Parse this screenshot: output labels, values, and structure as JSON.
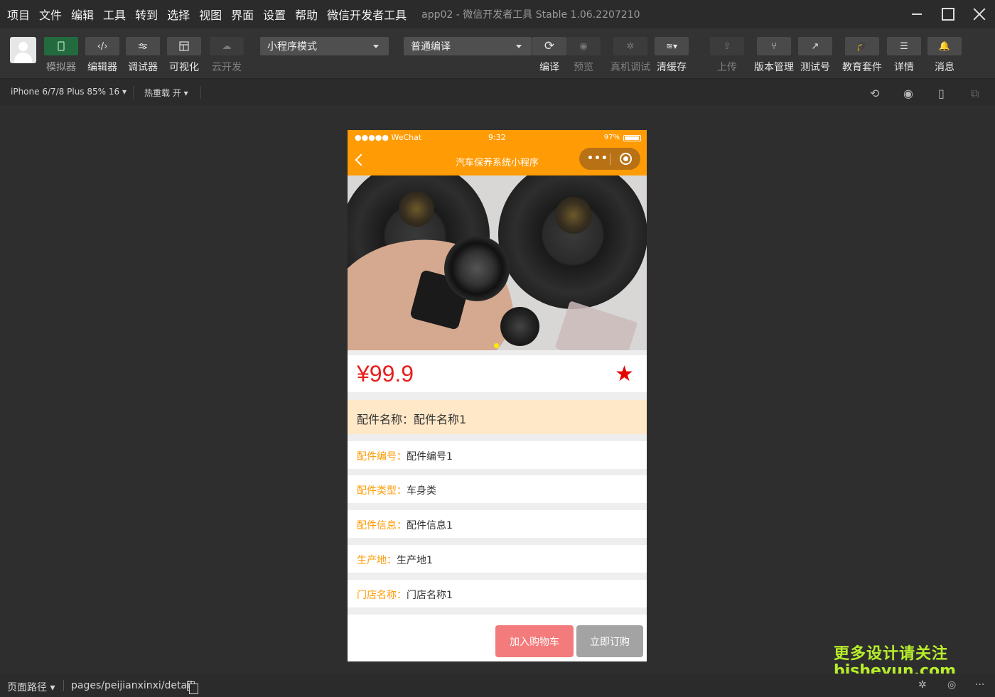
{
  "menu": [
    "项目",
    "文件",
    "编辑",
    "工具",
    "转到",
    "选择",
    "视图",
    "界面",
    "设置",
    "帮助",
    "微信开发者工具"
  ],
  "app_title": "app02 - 微信开发者工具 Stable 1.06.2207210",
  "toolbar": {
    "simulator": "模拟器",
    "editor": "编辑器",
    "debugger": "调试器",
    "visual": "可视化",
    "cloud": "云开发",
    "mode_select": "小程序模式",
    "compile_select": "普通编译",
    "compile": "编译",
    "preview": "预览",
    "remote_debug": "真机调试",
    "clear_cache": "清缓存",
    "upload": "上传",
    "version": "版本管理",
    "test_account": "测试号",
    "edu": "教育套件",
    "details": "详情",
    "messages": "消息"
  },
  "devicebar": {
    "device": "iPhone 6/7/8 Plus 85% 16 ▾",
    "hot_reload": "热重载 开 ▾"
  },
  "phone": {
    "signal": "●●●●● WeChat",
    "time": "9:32",
    "battery": "97%",
    "nav_title": "汽车保养系统小程序",
    "capsule_dots": "•••",
    "price": "¥99.9",
    "favorite_icon": "★",
    "part_name": "配件名称：配件名称1",
    "rows": [
      {
        "key": "配件编号：",
        "value": "配件编号1"
      },
      {
        "key": "配件类型：",
        "value": "车身类"
      },
      {
        "key": "配件信息：",
        "value": "配件信息1"
      },
      {
        "key": "生产地：",
        "value": "生产地1"
      },
      {
        "key": "门店名称：",
        "value": "门店名称1"
      }
    ],
    "add_to_cart": "加入购物车",
    "buy_now": "立即订购"
  },
  "bottombar": {
    "path_label": "页面路径 ▾",
    "path": "pages/peijianxinxi/detail"
  },
  "watermark": {
    "line1": "更多设计请关注",
    "line2": "bisheyun.com"
  },
  "colors": {
    "accent": "#ff9b05",
    "price": "#e8201b",
    "cart_button": "#f47b7b",
    "buy_button": "#a3a3a3"
  }
}
